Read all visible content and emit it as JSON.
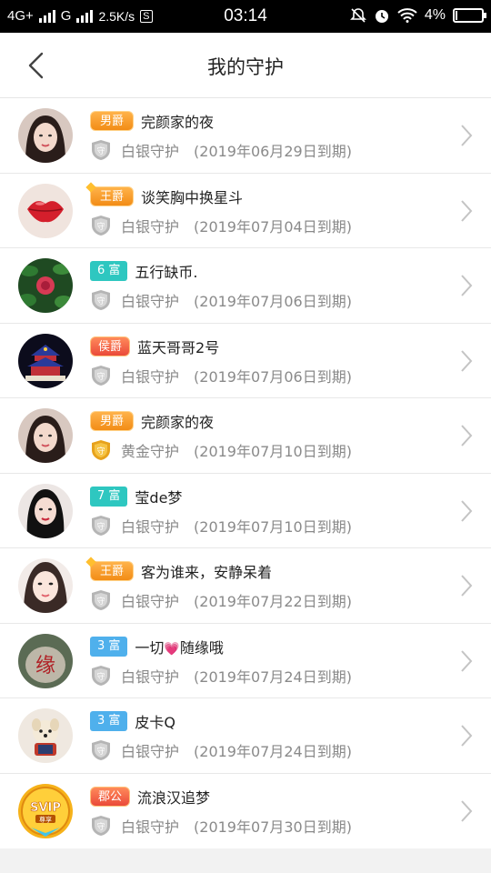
{
  "status_bar": {
    "network1": "4G+",
    "network2": "G",
    "speed": "2.5K/s",
    "time": "03:14",
    "battery": "4%"
  },
  "header": {
    "title": "我的守护"
  },
  "rows": [
    {
      "badge": "男爵",
      "badge_style": "title-badge",
      "name": "完颜家的夜",
      "guard": "白银守护",
      "expire": "(2019年06月29日到期)",
      "guard_type": "silver",
      "avatar": "woman-portrait"
    },
    {
      "badge": "王爵",
      "badge_style": "title-badge crown",
      "name": "谈笑胸中换星斗",
      "guard": "白银守护",
      "expire": "(2019年07月04日到期)",
      "guard_type": "silver",
      "avatar": "lips"
    },
    {
      "badge": "6 富",
      "badge_style": "wealth",
      "name": "五行缺币.",
      "guard": "白银守护",
      "expire": "(2019年07月06日到期)",
      "guard_type": "silver",
      "avatar": "rose"
    },
    {
      "badge": "侯爵",
      "badge_style": "duke",
      "name": "蓝天哥哥2号",
      "guard": "白银守护",
      "expire": "(2019年07月06日到期)",
      "guard_type": "silver",
      "avatar": "temple"
    },
    {
      "badge": "男爵",
      "badge_style": "title-badge",
      "name": "完颜家的夜",
      "guard": "黄金守护",
      "expire": "(2019年07月10日到期)",
      "guard_type": "gold",
      "avatar": "woman-portrait"
    },
    {
      "badge": "7 富",
      "badge_style": "wealth",
      "name": "莹de梦",
      "guard": "白银守护",
      "expire": "(2019年07月10日到期)",
      "guard_type": "silver",
      "avatar": "woman-dark-hair"
    },
    {
      "badge": "王爵",
      "badge_style": "title-badge crown",
      "name": "客为谁来，安静呆着",
      "guard": "白银守护",
      "expire": "(2019年07月22日到期)",
      "guard_type": "silver",
      "avatar": "woman-light"
    },
    {
      "badge": "3 富",
      "badge_style": "wealth blue",
      "name_pre": "一切",
      "heart": "💗",
      "name_post": "随缘哦",
      "guard": "白银守护",
      "expire": "(2019年07月24日到期)",
      "guard_type": "silver",
      "avatar": "stone"
    },
    {
      "badge": "3 富",
      "badge_style": "wealth blue",
      "name": "皮卡Q",
      "guard": "白银守护",
      "expire": "(2019年07月24日到期)",
      "guard_type": "silver",
      "avatar": "dog"
    },
    {
      "badge": "郡公",
      "badge_style": "duke",
      "name": "流浪汉追梦",
      "guard": "白银守护",
      "expire": "(2019年07月30日到期)",
      "guard_type": "silver",
      "avatar": "svip",
      "avatar_text": "SVIP",
      "avatar_sub": "尊享"
    }
  ]
}
